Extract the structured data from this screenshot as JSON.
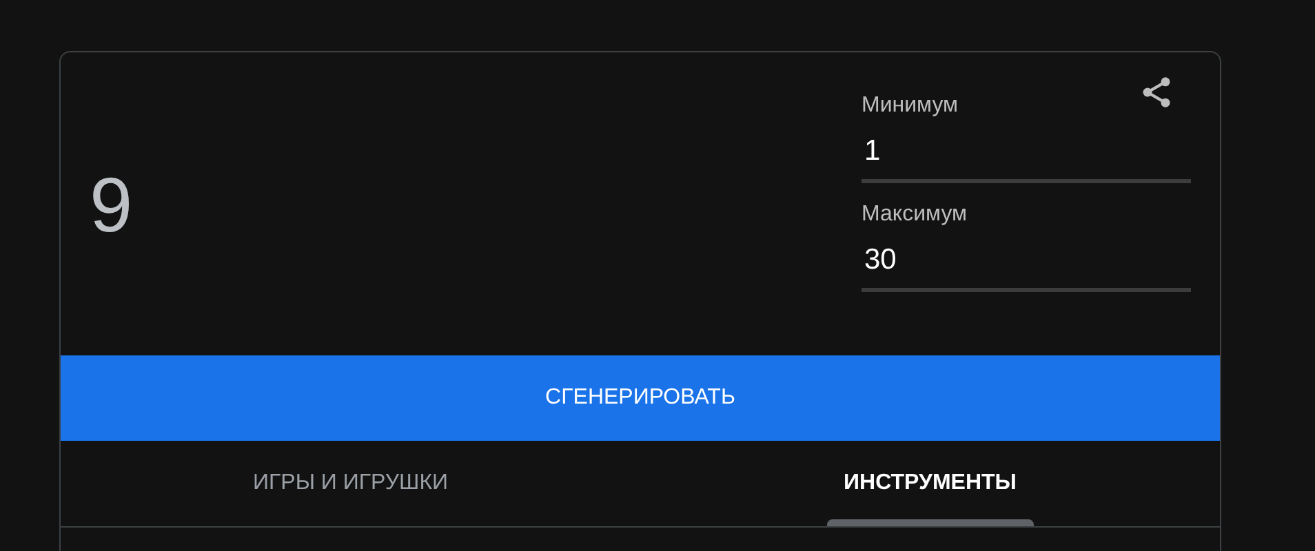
{
  "result": "9",
  "fields": [
    {
      "label": "Минимум",
      "value": "1"
    },
    {
      "label": "Максимум",
      "value": "30"
    }
  ],
  "generate_button": "СГЕНЕРИРОВАТЬ",
  "tabs": [
    {
      "label": "ИГРЫ И ИГРУШКИ",
      "selected": false
    },
    {
      "label": "ИНСТРУМЕНТЫ",
      "selected": true
    }
  ]
}
